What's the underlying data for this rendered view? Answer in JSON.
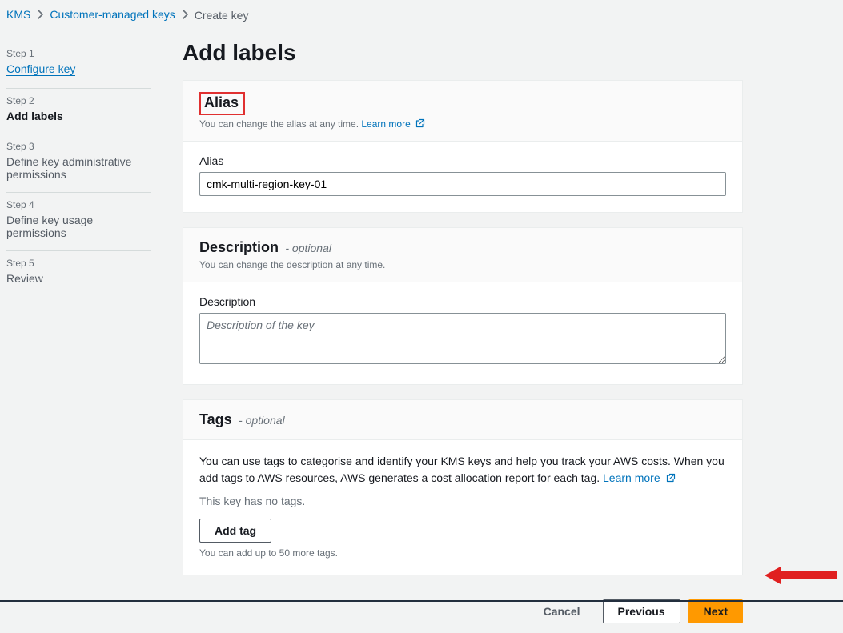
{
  "breadcrumb": {
    "root": "KMS",
    "mid": "Customer-managed keys",
    "current": "Create key"
  },
  "sidebar": {
    "steps": [
      {
        "label": "Step 1",
        "title": "Configure key",
        "state": "link"
      },
      {
        "label": "Step 2",
        "title": "Add labels",
        "state": "active"
      },
      {
        "label": "Step 3",
        "title": "Define key administrative permissions",
        "state": "future"
      },
      {
        "label": "Step 4",
        "title": "Define key usage permissions",
        "state": "future"
      },
      {
        "label": "Step 5",
        "title": "Review",
        "state": "future"
      }
    ]
  },
  "page": {
    "title": "Add labels"
  },
  "alias_panel": {
    "title": "Alias",
    "sub": "You can change the alias at any time.",
    "learn_more": "Learn more",
    "field_label": "Alias",
    "value": "cmk-multi-region-key-01"
  },
  "desc_panel": {
    "title": "Description",
    "optional": "- optional",
    "sub": "You can change the description at any time.",
    "field_label": "Description",
    "placeholder": "Description of the key",
    "value": ""
  },
  "tags_panel": {
    "title": "Tags",
    "optional": "- optional",
    "text_a": "You can use tags to categorise and identify your KMS keys and help you track your AWS costs. When you add tags to AWS resources, AWS generates a cost allocation report for each tag.",
    "learn_more": "Learn more",
    "no_tags": "This key has no tags.",
    "add_tag": "Add tag",
    "limit": "You can add up to 50 more tags."
  },
  "footer": {
    "cancel": "Cancel",
    "previous": "Previous",
    "next": "Next"
  }
}
